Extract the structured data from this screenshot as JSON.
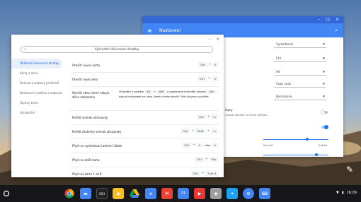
{
  "settings": {
    "title": "Nastavení",
    "selects": [
      "Vyhledávač",
      "Ctrl",
      "Alt",
      "Caps Lock",
      "Backspace"
    ],
    "toggle_text": "layvy",
    "toggle_desc": "choval tlačítek vrchním tlačítku.",
    "slider_left_label": "Dlouhé",
    "slider_right_label": "Krátká"
  },
  "viewer": {
    "search_placeholder": "Vyhledat klávesové zkratky",
    "categories": [
      "Oblíbené klávesové zkratky",
      "Karty a okna",
      "Stránka a webový prohlížeč",
      "Nastavení systému a zobrazení",
      "Úpravy textu",
      "Usnadnění"
    ],
    "rows": [
      {
        "desc": "Otevřít novou kartu",
        "keys": [
          "Ctrl",
          "+",
          "t"
        ]
      },
      {
        "desc": "Otevřít nové okno",
        "keys": [
          "Ctrl",
          "+",
          "n"
        ]
      },
      {
        "desc": "Otevřít okno, které nebylo dříve zobrazeno",
        "line1_pre": "Stiskněte a podržte",
        "line1_keys": [
          "Alt",
          "+",
          "shift"
        ],
        "line1_post": "a opakovaně stiskněte klávesu",
        "line2_key": "Tab",
        "line2_post": ", dokud nepřejdete na okno, které chcete otevřít. Poté klávesy uvolněte"
      },
      {
        "desc": "Pořídit snímek obrazovky",
        "keys": [
          "Ctrl",
          "+",
          "▭"
        ]
      },
      {
        "desc": "Pořídit částečný snímek obrazovky",
        "keys": [
          "Ctrl",
          "+",
          "Shift",
          "+",
          "▭"
        ]
      },
      {
        "desc": "Přejít na vyhledávací adresní řádek",
        "keys": [
          "Ctrl",
          "+",
          "k",
          "nebo",
          "e"
        ]
      },
      {
        "desc": "Přejít na další kartu",
        "keys": [
          "Ctrl",
          "+",
          "Tab"
        ]
      },
      {
        "desc": "Přejít na kartu 1 až 8",
        "keys": [
          "Ctrl",
          "+",
          "1 až 8"
        ]
      }
    ]
  },
  "shelf": {
    "apps": [
      "chrome-icon",
      "files-icon",
      "ssh-icon",
      "keep-icon",
      "drive-icon",
      "docs-icon",
      "gmail-icon",
      "calendar-icon",
      "youtube-icon",
      "camera-icon",
      "twitter-icon",
      "settings-icon",
      "shortcut-icon"
    ],
    "time": "16:09"
  }
}
